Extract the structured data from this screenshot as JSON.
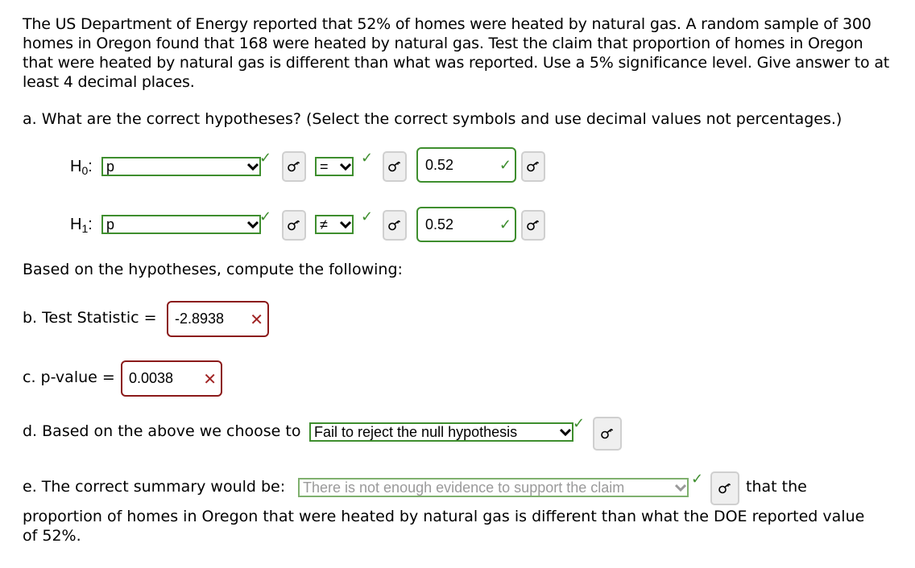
{
  "problem": {
    "text": "The US Department of Energy reported that 52% of homes were heated by natural gas. A random sample of 300 homes in Oregon found that 168 were heated by natural gas. Test the claim that proportion of homes in Oregon that were heated by natural gas is different than what was reported. Use a 5% significance level. Give answer to at least 4 decimal places."
  },
  "part_a": {
    "prompt": "a. What are the correct hypotheses? (Select the correct symbols and use decimal values not percentages.)",
    "h0": {
      "label_main": "H",
      "label_sub": "0",
      "colon": ":",
      "parameter": "p",
      "operator": "=",
      "value": "0.52"
    },
    "h1": {
      "label_main": "H",
      "label_sub": "1",
      "colon": ":",
      "parameter": "p",
      "operator": "≠",
      "value": "0.52"
    }
  },
  "compute_prompt": "Based on the hypotheses, compute the following:",
  "part_b": {
    "label": "b. Test Statistic =",
    "value": "-2.8938",
    "status": "incorrect"
  },
  "part_c": {
    "label": "c. p-value =",
    "value": "0.0038",
    "status": "incorrect"
  },
  "part_d": {
    "label": "d. Based on the above we choose to",
    "selection": "Fail to reject the null hypothesis",
    "status": "correct"
  },
  "part_e": {
    "label": "e. The correct summary would be:",
    "selection": "There is not enough evidence to support the claim",
    "after": "that the",
    "continuation": "proportion of homes in Oregon that were heated by natural gas is different than what the DOE reported value of 52%.",
    "status": "correct"
  },
  "icons": {
    "check": "✓",
    "cross": "✕",
    "key": "key-icon"
  },
  "colors": {
    "correct": "#3e8e2e",
    "incorrect": "#8b1a1a",
    "key_button_bg": "#efefef"
  }
}
